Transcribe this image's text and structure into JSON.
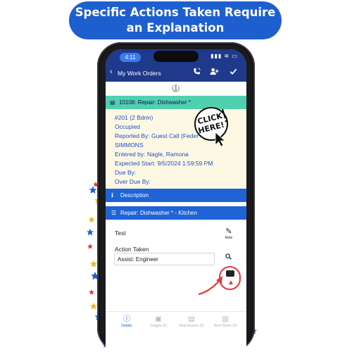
{
  "banner": {
    "line1": "Specific Actions Taken Require",
    "line2": "an Explanation"
  },
  "status_bar": {
    "time": "4:11",
    "icons": "▮▮▮ ≋ ▭"
  },
  "app_bar": {
    "back_icon": "chevron-left-icon",
    "title": "My Work Orders",
    "icons": [
      "phone-icon",
      "add-user-icon",
      "checkmark-icon"
    ]
  },
  "work_order": {
    "header": "10108: Repair: Dishwasher *",
    "lines": [
      "#201 (2 Bdrm)",
      "Occupied",
      "Reported By: Guest Call  (Feder",
      "SIMMONS",
      "Entered by: Nagle, Ramona",
      "Expected Start: 9/5/2024 1:59:59 PM",
      "Due By:",
      "Over Due By:"
    ]
  },
  "callout": {
    "line1": "CLICK",
    "line2": "HERE!"
  },
  "sections": {
    "description": "Description",
    "repair": "Repair: Dishwasher * - Kitchen"
  },
  "task": {
    "test_label": "Test",
    "note_label": "Note",
    "action_taken_label": "Action Taken",
    "assist_value": "Assist: Engineer"
  },
  "bottom_nav": [
    {
      "label": "Details",
      "icon": "info-icon"
    },
    {
      "label": "Images (0)",
      "icon": "image-icon"
    },
    {
      "label": "Attachments (0)",
      "icon": "document-icon"
    },
    {
      "label": "Rent Notes (0)",
      "icon": "book-icon"
    }
  ],
  "colors": {
    "banner": "#1e5fd0",
    "app_bar": "#1f3a8a",
    "wo_header": "#4fd1b0",
    "wo_body": "#fdf8e3",
    "section_bar": "#1f63d6",
    "alert_red": "#e23b3b"
  }
}
